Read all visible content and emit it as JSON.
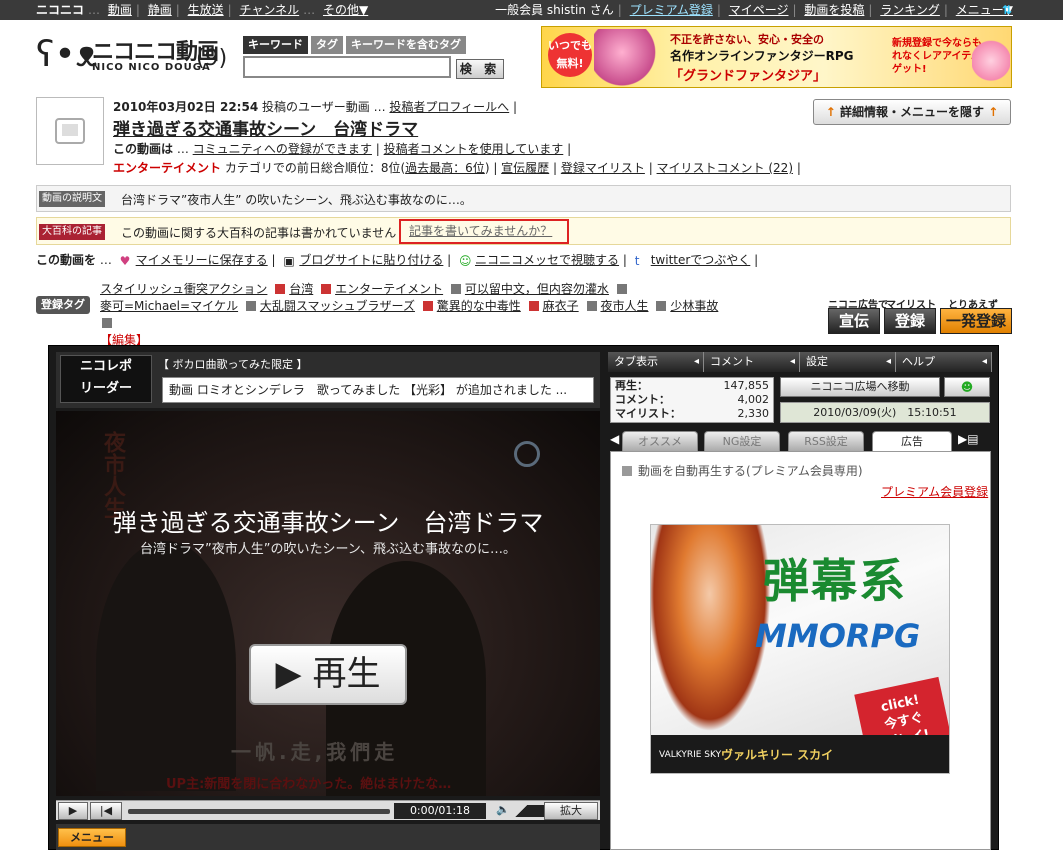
{
  "topbar": {
    "items_left": [
      "ニコニコ",
      "動画",
      "静画",
      "生放送",
      "チャンネル",
      "その他▼"
    ],
    "user": "一般会員 shistin さん",
    "premium": "プレミアム登録",
    "items_right": [
      "マイページ",
      "動画を投稿",
      "ランキング",
      "メニュー▼"
    ]
  },
  "logo": {
    "jp": "ニコニコ動画",
    "en": "NICO NICO DOUGA",
    "ver": "(9)"
  },
  "search": {
    "tabs": [
      "キーワード",
      "タグ",
      "キーワードを含むタグ"
    ],
    "button": "検 索"
  },
  "top_banner": {
    "badge": "いつでも無料!",
    "line1": "不正を許さない、安心・安全の",
    "line2": "名作オンラインファンタジーRPG",
    "line3": "「グランドファンタジア」",
    "side": "新規登録で今ならもれなくレアアイテムゲット!"
  },
  "video": {
    "date": "2010年03月02日 22:54",
    "post_type": "投稿のユーザー動画",
    "profile_link": "投稿者プロフィールへ",
    "title": "弾き過ぎる交通事故シーン　台湾ドラマ",
    "community_label": "この動画は",
    "community_link": "コミュニティへの登録ができます",
    "comment_link": "投稿者コメントを使用しています",
    "category": "エンターテイメント",
    "rank_text": "カテゴリでの前日総合順位：8位(",
    "rank_best": "過去最高：6位",
    "rank_close": ")",
    "ad_history": "宣伝履歴",
    "mylist_reg": "登録マイリスト",
    "mylist_comment": "マイリストコメント (22)",
    "hide_button": "詳細情報・メニューを隠す"
  },
  "desc": {
    "label": "動画の説明文",
    "text": "台湾ドラマ”夜市人生” の吹いたシーン、飛ぶ込む事故なのに…。"
  },
  "dic": {
    "label": "大百科の記事",
    "text": "この動画に関する大百科の記事は書かれていません",
    "write": "記事を書いてみませんか？"
  },
  "actions": {
    "prefix": "この動画を",
    "memory": "マイメモリーに保存する",
    "blog": "ブログサイトに貼り付ける",
    "messe": "ニコニコメッセで視聴する",
    "twitter": "twitterでつぶやく"
  },
  "tags": {
    "button": "登録タグ",
    "list": [
      "スタイリッシュ衝突アクション",
      "台湾",
      "エンターテイメント",
      "可以留中文，但内容勿灌水",
      "麥可=Michael=マイケル",
      "大乱闘スマッシュブラザーズ",
      "驚異的な中毒性",
      "麻衣子",
      "夜市人生",
      "少林事故"
    ],
    "edit": "【編集】"
  },
  "reg_buttons": {
    "cap_ad": "ニコニ広告で",
    "cap_mylist": "マイリスト",
    "cap_toriaezu": "とりあえず",
    "ad": "宣伝",
    "reg": "登録",
    "quick": "一発登録"
  },
  "player": {
    "logo": "ニコレポ\nリーダー",
    "sub": "【 ボカロ曲歌ってみた限定 】",
    "news": "動画 ロミオとシンデレラ　歌ってみました 【光彩】 が追加されました ...",
    "v_title": "弾き過ぎる交通事故シーン　台湾ドラマ",
    "v_desc": "台湾ドラマ”夜市人生”の吹いたシーン、飛ぶ込む事故なのに…。",
    "ghost_sign": "夜市人生",
    "ghost_sub": "一帆.走,我們走",
    "ghost_red": "UP主:新聞を閉に合わなかった。絶はまけたな…",
    "play": "▶ 再生",
    "time": "0:00/01:18",
    "expand": "拡大",
    "menu": "メニュー"
  },
  "panel": {
    "tabs": [
      "タブ表示",
      "コメント",
      "設定",
      "ヘルプ"
    ],
    "stats": [
      {
        "label": "再生：",
        "value": "147,855"
      },
      {
        "label": "コメント：",
        "value": "4,002"
      },
      {
        "label": "マイリスト：",
        "value": "2,330"
      }
    ],
    "plaza": "ニコニコ広場へ移動",
    "date": "2010/03/09(火)　15:10:51",
    "content_tabs": [
      "オススメ",
      "NG設定",
      "RSS設定",
      "広告"
    ],
    "autoplay": "動画を自動再生する(プレミアム会員専用)",
    "premium_reg": "プレミアム会員登録",
    "ad_title": "弾幕系",
    "ad_sub": "MMORPG",
    "ad_click": "click!\n今すぐ\nプレイ!",
    "ad_game": "ヴァルキリー スカイ",
    "ad_logo": "VALKYRIE SKY"
  }
}
